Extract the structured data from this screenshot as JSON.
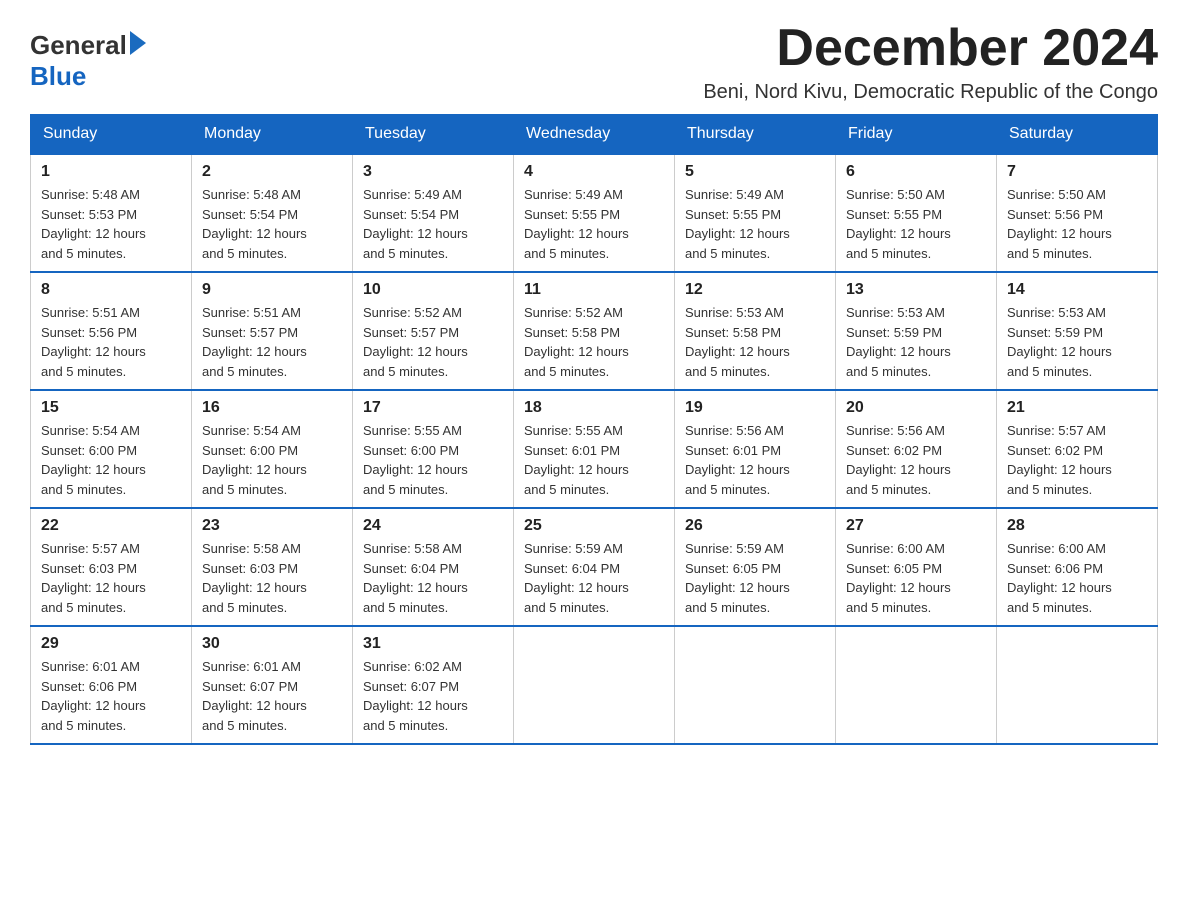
{
  "header": {
    "logo_general": "General",
    "logo_blue": "Blue",
    "month_title": "December 2024",
    "subtitle": "Beni, Nord Kivu, Democratic Republic of the Congo"
  },
  "days_of_week": [
    "Sunday",
    "Monday",
    "Tuesday",
    "Wednesday",
    "Thursday",
    "Friday",
    "Saturday"
  ],
  "weeks": [
    [
      {
        "day": "1",
        "sunrise": "5:48 AM",
        "sunset": "5:53 PM",
        "daylight": "12 hours and 5 minutes."
      },
      {
        "day": "2",
        "sunrise": "5:48 AM",
        "sunset": "5:54 PM",
        "daylight": "12 hours and 5 minutes."
      },
      {
        "day": "3",
        "sunrise": "5:49 AM",
        "sunset": "5:54 PM",
        "daylight": "12 hours and 5 minutes."
      },
      {
        "day": "4",
        "sunrise": "5:49 AM",
        "sunset": "5:55 PM",
        "daylight": "12 hours and 5 minutes."
      },
      {
        "day": "5",
        "sunrise": "5:49 AM",
        "sunset": "5:55 PM",
        "daylight": "12 hours and 5 minutes."
      },
      {
        "day": "6",
        "sunrise": "5:50 AM",
        "sunset": "5:55 PM",
        "daylight": "12 hours and 5 minutes."
      },
      {
        "day": "7",
        "sunrise": "5:50 AM",
        "sunset": "5:56 PM",
        "daylight": "12 hours and 5 minutes."
      }
    ],
    [
      {
        "day": "8",
        "sunrise": "5:51 AM",
        "sunset": "5:56 PM",
        "daylight": "12 hours and 5 minutes."
      },
      {
        "day": "9",
        "sunrise": "5:51 AM",
        "sunset": "5:57 PM",
        "daylight": "12 hours and 5 minutes."
      },
      {
        "day": "10",
        "sunrise": "5:52 AM",
        "sunset": "5:57 PM",
        "daylight": "12 hours and 5 minutes."
      },
      {
        "day": "11",
        "sunrise": "5:52 AM",
        "sunset": "5:58 PM",
        "daylight": "12 hours and 5 minutes."
      },
      {
        "day": "12",
        "sunrise": "5:53 AM",
        "sunset": "5:58 PM",
        "daylight": "12 hours and 5 minutes."
      },
      {
        "day": "13",
        "sunrise": "5:53 AM",
        "sunset": "5:59 PM",
        "daylight": "12 hours and 5 minutes."
      },
      {
        "day": "14",
        "sunrise": "5:53 AM",
        "sunset": "5:59 PM",
        "daylight": "12 hours and 5 minutes."
      }
    ],
    [
      {
        "day": "15",
        "sunrise": "5:54 AM",
        "sunset": "6:00 PM",
        "daylight": "12 hours and 5 minutes."
      },
      {
        "day": "16",
        "sunrise": "5:54 AM",
        "sunset": "6:00 PM",
        "daylight": "12 hours and 5 minutes."
      },
      {
        "day": "17",
        "sunrise": "5:55 AM",
        "sunset": "6:00 PM",
        "daylight": "12 hours and 5 minutes."
      },
      {
        "day": "18",
        "sunrise": "5:55 AM",
        "sunset": "6:01 PM",
        "daylight": "12 hours and 5 minutes."
      },
      {
        "day": "19",
        "sunrise": "5:56 AM",
        "sunset": "6:01 PM",
        "daylight": "12 hours and 5 minutes."
      },
      {
        "day": "20",
        "sunrise": "5:56 AM",
        "sunset": "6:02 PM",
        "daylight": "12 hours and 5 minutes."
      },
      {
        "day": "21",
        "sunrise": "5:57 AM",
        "sunset": "6:02 PM",
        "daylight": "12 hours and 5 minutes."
      }
    ],
    [
      {
        "day": "22",
        "sunrise": "5:57 AM",
        "sunset": "6:03 PM",
        "daylight": "12 hours and 5 minutes."
      },
      {
        "day": "23",
        "sunrise": "5:58 AM",
        "sunset": "6:03 PM",
        "daylight": "12 hours and 5 minutes."
      },
      {
        "day": "24",
        "sunrise": "5:58 AM",
        "sunset": "6:04 PM",
        "daylight": "12 hours and 5 minutes."
      },
      {
        "day": "25",
        "sunrise": "5:59 AM",
        "sunset": "6:04 PM",
        "daylight": "12 hours and 5 minutes."
      },
      {
        "day": "26",
        "sunrise": "5:59 AM",
        "sunset": "6:05 PM",
        "daylight": "12 hours and 5 minutes."
      },
      {
        "day": "27",
        "sunrise": "6:00 AM",
        "sunset": "6:05 PM",
        "daylight": "12 hours and 5 minutes."
      },
      {
        "day": "28",
        "sunrise": "6:00 AM",
        "sunset": "6:06 PM",
        "daylight": "12 hours and 5 minutes."
      }
    ],
    [
      {
        "day": "29",
        "sunrise": "6:01 AM",
        "sunset": "6:06 PM",
        "daylight": "12 hours and 5 minutes."
      },
      {
        "day": "30",
        "sunrise": "6:01 AM",
        "sunset": "6:07 PM",
        "daylight": "12 hours and 5 minutes."
      },
      {
        "day": "31",
        "sunrise": "6:02 AM",
        "sunset": "6:07 PM",
        "daylight": "12 hours and 5 minutes."
      },
      null,
      null,
      null,
      null
    ]
  ],
  "labels": {
    "sunrise": "Sunrise:",
    "sunset": "Sunset:",
    "daylight": "Daylight:"
  }
}
